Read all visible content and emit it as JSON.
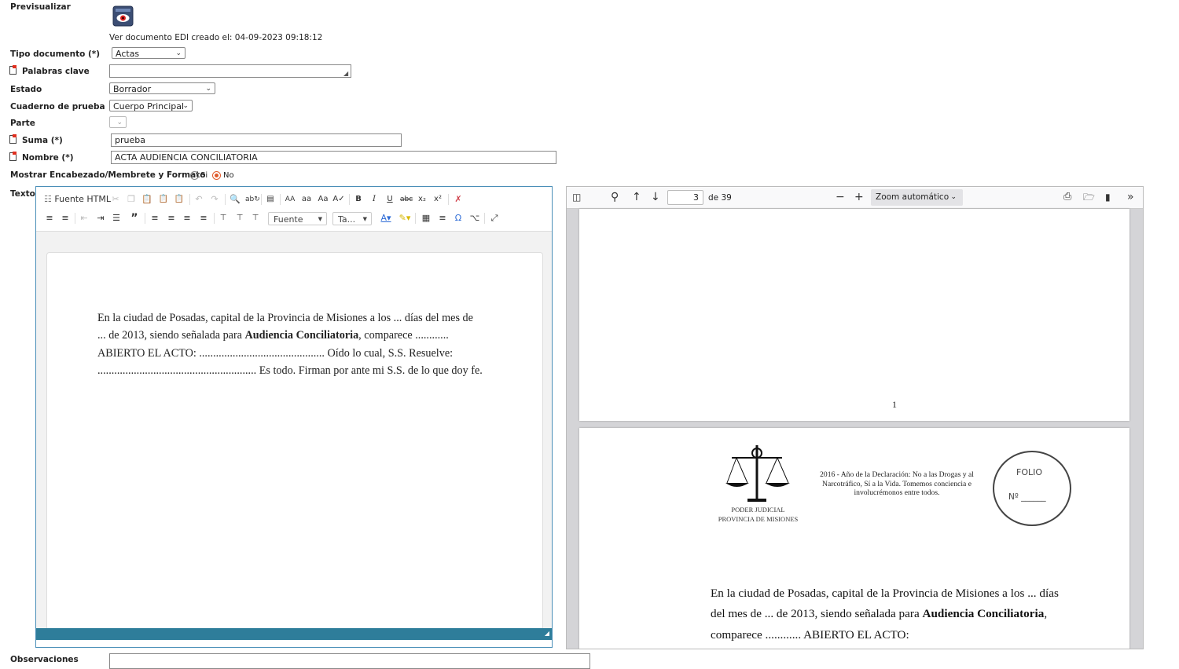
{
  "form": {
    "preview_label": "Previsualizar",
    "edi_info": "Ver documento EDI creado el: 04-09-2023 09:18:12",
    "tipo_documento_label": "Tipo documento (*)",
    "tipo_documento_value": "Actas",
    "palabras_clave_label": "Palabras clave",
    "palabras_clave_value": "",
    "estado_label": "Estado",
    "estado_value": "Borrador",
    "cuaderno_label": "Cuaderno de prueba",
    "cuaderno_value": "Cuerpo Principal",
    "parte_label": "Parte",
    "parte_value": "",
    "suma_label": "Suma (*)",
    "suma_value": "prueba",
    "nombre_label": "Nombre (*)",
    "nombre_value": "ACTA AUDIENCIA CONCILIATORIA",
    "mostrar_label": "Mostrar Encabezado/Membrete y Formato",
    "radio_si": "Si",
    "radio_no": "No",
    "radio_selected": "No",
    "texto_label": "Texto",
    "observaciones_label": "Observaciones"
  },
  "editor": {
    "source_button": "Fuente HTML",
    "font_combo": "Fuente",
    "size_combo": "Ta...",
    "body_p1": "En la ciudad de Posadas, capital de la Provincia de Misiones a los ... días del mes de ... de 2013, siendo señalada para ",
    "body_bold": "Audiencia Conciliatoria",
    "body_p2": ", comparece ............ ABIERTO EL ACTO: ............................................. Oído lo cual, S.S. Resuelve: ......................................................... Es todo. Firman por ante mi S.S. de lo que doy fe.",
    "accent_color": "#2e7d9a"
  },
  "pdf": {
    "current_page": "3",
    "total_pages": "de 39",
    "zoom": "Zoom automático",
    "page_number_footer": "1",
    "seal_line1": "PODER JUDICIAL",
    "seal_line2": "PROVINCIA DE MISIONES",
    "header_motto": "2016 - Año de la Declaración: No a las Drogas y al Narcotráfico, Sí a la Vida. Tomemos conciencia e involucrémonos entre todos.",
    "folio_label": "FOLIO",
    "folio_num": "Nº ______",
    "body_p1": "En la ciudad de Posadas, capital de la Provincia de Misiones a los ... días del mes de ... de 2013, siendo señalada para ",
    "body_bold": "Audiencia Conciliatoria",
    "body_p2": ", comparece ............ ABIERTO EL ACTO:"
  }
}
